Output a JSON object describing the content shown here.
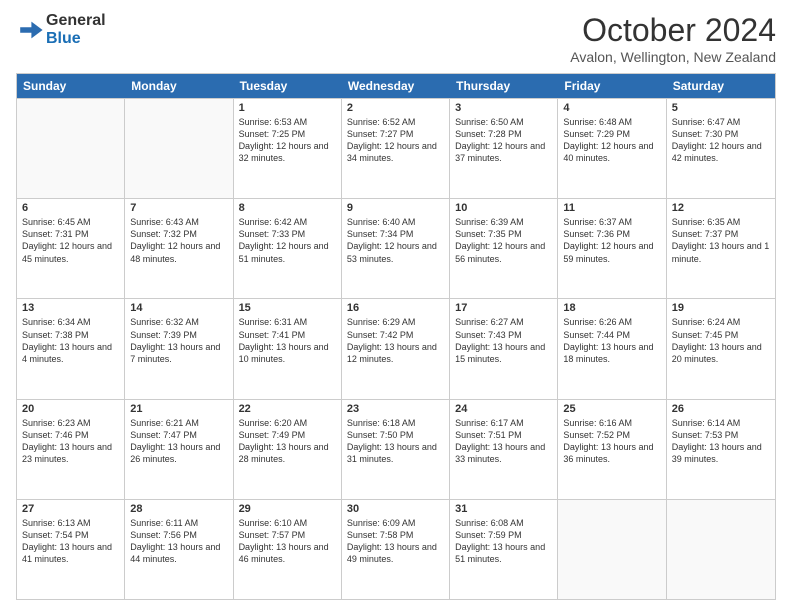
{
  "header": {
    "logo": {
      "general": "General",
      "blue": "Blue"
    },
    "title": "October 2024",
    "subtitle": "Avalon, Wellington, New Zealand"
  },
  "calendar": {
    "days": [
      "Sunday",
      "Monday",
      "Tuesday",
      "Wednesday",
      "Thursday",
      "Friday",
      "Saturday"
    ],
    "rows": [
      [
        {
          "day": "",
          "info": ""
        },
        {
          "day": "",
          "info": ""
        },
        {
          "day": "1",
          "info": "Sunrise: 6:53 AM\nSunset: 7:25 PM\nDaylight: 12 hours and 32 minutes."
        },
        {
          "day": "2",
          "info": "Sunrise: 6:52 AM\nSunset: 7:27 PM\nDaylight: 12 hours and 34 minutes."
        },
        {
          "day": "3",
          "info": "Sunrise: 6:50 AM\nSunset: 7:28 PM\nDaylight: 12 hours and 37 minutes."
        },
        {
          "day": "4",
          "info": "Sunrise: 6:48 AM\nSunset: 7:29 PM\nDaylight: 12 hours and 40 minutes."
        },
        {
          "day": "5",
          "info": "Sunrise: 6:47 AM\nSunset: 7:30 PM\nDaylight: 12 hours and 42 minutes."
        }
      ],
      [
        {
          "day": "6",
          "info": "Sunrise: 6:45 AM\nSunset: 7:31 PM\nDaylight: 12 hours and 45 minutes."
        },
        {
          "day": "7",
          "info": "Sunrise: 6:43 AM\nSunset: 7:32 PM\nDaylight: 12 hours and 48 minutes."
        },
        {
          "day": "8",
          "info": "Sunrise: 6:42 AM\nSunset: 7:33 PM\nDaylight: 12 hours and 51 minutes."
        },
        {
          "day": "9",
          "info": "Sunrise: 6:40 AM\nSunset: 7:34 PM\nDaylight: 12 hours and 53 minutes."
        },
        {
          "day": "10",
          "info": "Sunrise: 6:39 AM\nSunset: 7:35 PM\nDaylight: 12 hours and 56 minutes."
        },
        {
          "day": "11",
          "info": "Sunrise: 6:37 AM\nSunset: 7:36 PM\nDaylight: 12 hours and 59 minutes."
        },
        {
          "day": "12",
          "info": "Sunrise: 6:35 AM\nSunset: 7:37 PM\nDaylight: 13 hours and 1 minute."
        }
      ],
      [
        {
          "day": "13",
          "info": "Sunrise: 6:34 AM\nSunset: 7:38 PM\nDaylight: 13 hours and 4 minutes."
        },
        {
          "day": "14",
          "info": "Sunrise: 6:32 AM\nSunset: 7:39 PM\nDaylight: 13 hours and 7 minutes."
        },
        {
          "day": "15",
          "info": "Sunrise: 6:31 AM\nSunset: 7:41 PM\nDaylight: 13 hours and 10 minutes."
        },
        {
          "day": "16",
          "info": "Sunrise: 6:29 AM\nSunset: 7:42 PM\nDaylight: 13 hours and 12 minutes."
        },
        {
          "day": "17",
          "info": "Sunrise: 6:27 AM\nSunset: 7:43 PM\nDaylight: 13 hours and 15 minutes."
        },
        {
          "day": "18",
          "info": "Sunrise: 6:26 AM\nSunset: 7:44 PM\nDaylight: 13 hours and 18 minutes."
        },
        {
          "day": "19",
          "info": "Sunrise: 6:24 AM\nSunset: 7:45 PM\nDaylight: 13 hours and 20 minutes."
        }
      ],
      [
        {
          "day": "20",
          "info": "Sunrise: 6:23 AM\nSunset: 7:46 PM\nDaylight: 13 hours and 23 minutes."
        },
        {
          "day": "21",
          "info": "Sunrise: 6:21 AM\nSunset: 7:47 PM\nDaylight: 13 hours and 26 minutes."
        },
        {
          "day": "22",
          "info": "Sunrise: 6:20 AM\nSunset: 7:49 PM\nDaylight: 13 hours and 28 minutes."
        },
        {
          "day": "23",
          "info": "Sunrise: 6:18 AM\nSunset: 7:50 PM\nDaylight: 13 hours and 31 minutes."
        },
        {
          "day": "24",
          "info": "Sunrise: 6:17 AM\nSunset: 7:51 PM\nDaylight: 13 hours and 33 minutes."
        },
        {
          "day": "25",
          "info": "Sunrise: 6:16 AM\nSunset: 7:52 PM\nDaylight: 13 hours and 36 minutes."
        },
        {
          "day": "26",
          "info": "Sunrise: 6:14 AM\nSunset: 7:53 PM\nDaylight: 13 hours and 39 minutes."
        }
      ],
      [
        {
          "day": "27",
          "info": "Sunrise: 6:13 AM\nSunset: 7:54 PM\nDaylight: 13 hours and 41 minutes."
        },
        {
          "day": "28",
          "info": "Sunrise: 6:11 AM\nSunset: 7:56 PM\nDaylight: 13 hours and 44 minutes."
        },
        {
          "day": "29",
          "info": "Sunrise: 6:10 AM\nSunset: 7:57 PM\nDaylight: 13 hours and 46 minutes."
        },
        {
          "day": "30",
          "info": "Sunrise: 6:09 AM\nSunset: 7:58 PM\nDaylight: 13 hours and 49 minutes."
        },
        {
          "day": "31",
          "info": "Sunrise: 6:08 AM\nSunset: 7:59 PM\nDaylight: 13 hours and 51 minutes."
        },
        {
          "day": "",
          "info": ""
        },
        {
          "day": "",
          "info": ""
        }
      ]
    ]
  }
}
